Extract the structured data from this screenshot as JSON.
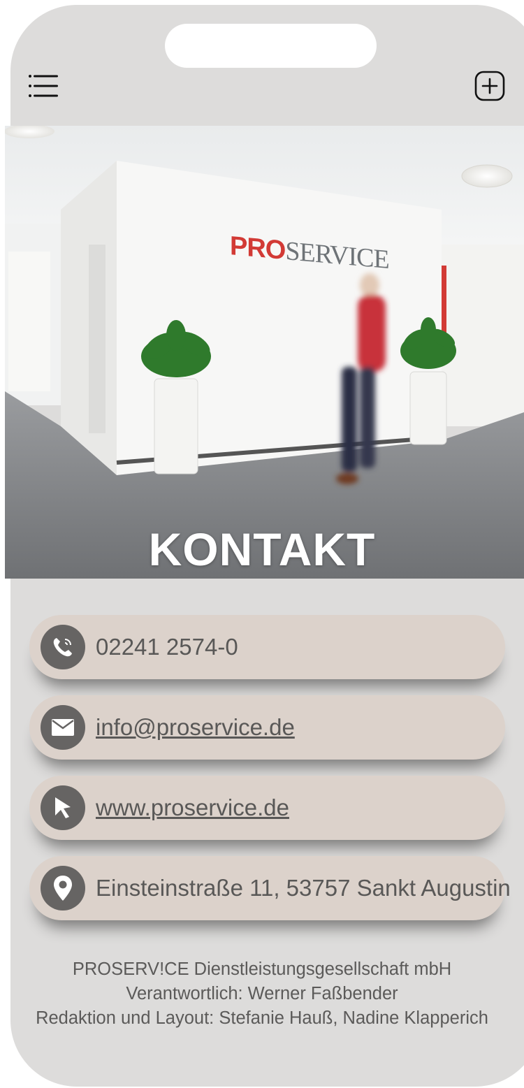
{
  "hero": {
    "title": "KONTAKT",
    "wall_sign": {
      "part1": "PRO",
      "part2": "SERVICE"
    }
  },
  "icons": {
    "menu": "menu-list-icon",
    "add": "plus-square-icon",
    "phone": "phone-icon",
    "email": "envelope-icon",
    "web": "cursor-arrow-icon",
    "address": "map-pin-icon"
  },
  "contacts": {
    "phone": "02241 2574-0",
    "email": "info@proservice.de",
    "website": "www.proservice.de",
    "address": "Einsteinstraße 11, 53757 Sankt Augustin"
  },
  "footer": {
    "line1": "PROSERV!CE Dienstleistungsgesellschaft mbH",
    "line2": "Verantwortlich: Werner Faßbender",
    "line3": "Redaktion und Layout: Stefanie Hauß, Nadine Klapperich"
  },
  "colors": {
    "frame": "#dddcdb",
    "pill": "#dcd2cb",
    "icon_circle": "#666463",
    "text": "#595857",
    "brand_red": "#d23a35"
  }
}
